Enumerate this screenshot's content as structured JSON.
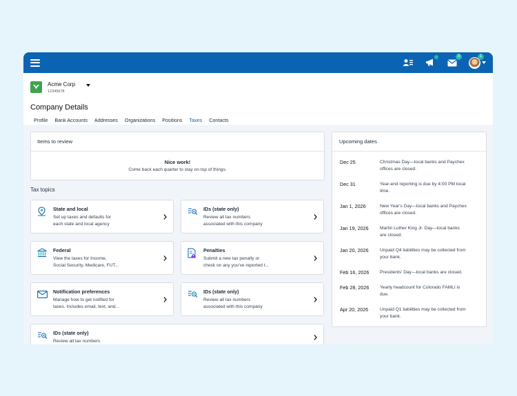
{
  "company": {
    "name": "Acme Corp",
    "id": "12345678"
  },
  "page_title": "Company Details",
  "tabs": [
    {
      "label": "Profile"
    },
    {
      "label": "Bank Accounts"
    },
    {
      "label": "Addresses"
    },
    {
      "label": "Organizations"
    },
    {
      "label": "Positions"
    },
    {
      "label": "Taxes"
    },
    {
      "label": "Contacts"
    }
  ],
  "active_tab": "Taxes",
  "header_badges": {
    "messages": "3",
    "avatar": "1"
  },
  "review": {
    "title": "Items to review",
    "headline": "Nice work!",
    "message": "Come back each quarter to stay on top of things."
  },
  "tax_topics": {
    "title": "Tax topics",
    "items": [
      {
        "title": "State and local",
        "desc1": "Set up taxes and defaults for",
        "desc2": "each state and local agency",
        "icon": "location-pin-icon"
      },
      {
        "title": "IDs (state only)",
        "desc1": "Review all tax numbers",
        "desc2": "associated with this company",
        "icon": "id-list-icon"
      },
      {
        "title": "Federal",
        "desc1": "View the taxes for Income,",
        "desc2": "Social Security, Medicare, FUT...",
        "icon": "bank-icon"
      },
      {
        "title": "Penalties",
        "desc1": "Submit a new tax penalty or",
        "desc2": "check on any you've reported t...",
        "icon": "penalty-document-icon"
      },
      {
        "title": "Notification preferences",
        "desc1": "Manage how to get notified for",
        "desc2": "taxes. Includes email, text, and...",
        "icon": "envelope-icon"
      },
      {
        "title": "IDs (state only)",
        "desc1": "Review all tax numbers",
        "desc2": "associated with this company",
        "icon": "id-list-icon"
      },
      {
        "title": "IDs (state only)",
        "desc1": "Review all tax numbers",
        "desc2": "",
        "icon": "id-list-icon"
      }
    ]
  },
  "upcoming": {
    "title": "Upcoming dates",
    "events": [
      {
        "date": "Dec 25",
        "desc1": "Christmas Day—local banks and Paychex",
        "desc2": "offices are closed."
      },
      {
        "date": "Dec 31",
        "desc1": "Year-end reporting is due by 4:00 PM local",
        "desc2": "time."
      },
      {
        "date": "Jan 1, 2026",
        "desc1": "New Year's Day—local banks and Paychex",
        "desc2": "offices are closed."
      },
      {
        "date": "Jan 19, 2026",
        "desc1": "Martin Luther King Jr. Day—local banks",
        "desc2": "are closed."
      },
      {
        "date": "Jan 20, 2026",
        "desc1": "Unpaid Q4 liabilities may be collected from",
        "desc2": "your bank."
      },
      {
        "date": "Feb 16, 2026",
        "desc1": "Presidents' Day—local banks are closed.",
        "desc2": ""
      },
      {
        "date": "Feb 28, 2026",
        "desc1": "Yearly headcount for Colorado FAMLI is",
        "desc2": "due."
      },
      {
        "date": "Apr 20, 2026",
        "desc1": "Unpaid Q1 liabilities may be collected from",
        "desc2": "your bank."
      }
    ]
  },
  "colors": {
    "brand": "#0b64b3",
    "accent": "#22b8b0",
    "logo": "#3fa34d"
  }
}
